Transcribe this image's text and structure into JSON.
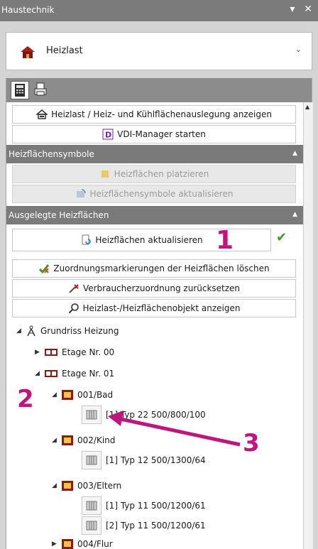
{
  "window": {
    "title": "Haustechnik",
    "controls": "▾ ✕"
  },
  "module_dropdown": {
    "selected": "Heizlast",
    "icon": "house-heat-icon"
  },
  "toolbar": {
    "tabs": [
      {
        "icon": "calculator-icon"
      },
      {
        "icon": "printer-icon"
      }
    ]
  },
  "buttons": {
    "show_heatload": "Heizlast / Heiz- und Kühlflächenauslegung anzeigen",
    "vdi_manager": "VDI-Manager starten"
  },
  "section_symbols": {
    "title": "Heizflächensymbole",
    "place": "Heizflächen platzieren",
    "update_symbols": "Heizflächensymbole aktualisieren"
  },
  "section_designed": {
    "title": "Ausgelegte Heizflächen",
    "update": "Heizflächen aktualisieren",
    "delete_markers": "Zuordnungsmarkierungen der Heizflächen löschen",
    "reset_assignment": "Verbraucherzuordnung zurücksetzen",
    "show_object": "Heizlast-/Heizflächenobjekt anzeigen"
  },
  "tree": {
    "root": "Grundriss Heizung",
    "floors": [
      {
        "label": "Etage Nr. 00",
        "expanded": false
      },
      {
        "label": "Etage Nr. 01",
        "expanded": true
      }
    ],
    "rooms": [
      {
        "label": "001/Bad",
        "radiators": [
          "[1] Typ 22 500/800/100"
        ]
      },
      {
        "label": "002/Kind",
        "radiators": [
          "[1] Typ 12 500/1300/64"
        ]
      },
      {
        "label": "003/Eltern",
        "radiators": [
          "[1] Typ 11 500/1200/61",
          "[2] Typ 11 500/1200/61"
        ]
      },
      {
        "label": "004/Flur",
        "radiators": []
      }
    ]
  },
  "annotations": {
    "a1": "1",
    "a2": "2",
    "a3": "3"
  },
  "colors": {
    "annotation": "#c0157e",
    "check": "#3c9a2a",
    "header": "#7a7a7a"
  }
}
